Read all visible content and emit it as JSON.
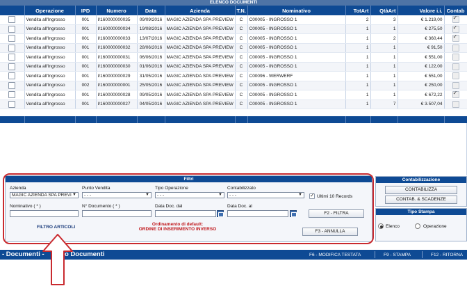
{
  "documents": {
    "title": "ELENCO DOCUMENTI",
    "columns": [
      "Operazione",
      "IPD",
      "Numero",
      "Data",
      "Azienda",
      "T.N.",
      "Nominativo",
      "TotArt",
      "QtàArt",
      "Valore i.i.",
      "Contab"
    ],
    "rows": [
      {
        "operazione": "Vendita all'Ingrosso",
        "ipd": "001",
        "numero": "I/160000000035",
        "data": "09/09/2016",
        "azienda": "MAGIC AZIENDA SPA PREVIEW",
        "tn": "C",
        "nominativo": "C00005 - INGROSSO 1",
        "totart": "2",
        "qtaart": "3",
        "valore": "€ 1.219,00",
        "contab": true,
        "selected": false
      },
      {
        "operazione": "Vendita all'Ingrosso",
        "ipd": "001",
        "numero": "I/160000000034",
        "data": "19/08/2016",
        "azienda": "MAGIC AZIENDA SPA PREVIEW",
        "tn": "C",
        "nominativo": "C00005 - INGROSSO 1",
        "totart": "1",
        "qtaart": "1",
        "valore": "€ 275,50",
        "contab": true,
        "selected": false
      },
      {
        "operazione": "Vendita all'Ingrosso",
        "ipd": "001",
        "numero": "I/160000000033",
        "data": "13/07/2016",
        "azienda": "MAGIC AZIENDA SPA PREVIEW",
        "tn": "C",
        "nominativo": "C00005 - INGROSSO 1",
        "totart": "1",
        "qtaart": "2",
        "valore": "€ 360,44",
        "contab": true,
        "selected": false
      },
      {
        "operazione": "Vendita all'Ingrosso",
        "ipd": "001",
        "numero": "I/160000000032",
        "data": "28/06/2016",
        "azienda": "MAGIC AZIENDA SPA PREVIEW",
        "tn": "C",
        "nominativo": "C00005 - INGROSSO 1",
        "totart": "1",
        "qtaart": "1",
        "valore": "€ 91,50",
        "contab": false,
        "selected": false
      },
      {
        "operazione": "Vendita all'Ingrosso",
        "ipd": "001",
        "numero": "I/160000000031",
        "data": "06/06/2016",
        "azienda": "MAGIC AZIENDA SPA PREVIEW",
        "tn": "C",
        "nominativo": "C00005 - INGROSSO 1",
        "totart": "1",
        "qtaart": "1",
        "valore": "€ 551,00",
        "contab": false,
        "selected": false
      },
      {
        "operazione": "Vendita all'Ingrosso",
        "ipd": "001",
        "numero": "I/160000000030",
        "data": "01/06/2016",
        "azienda": "MAGIC AZIENDA SPA PREVIEW",
        "tn": "C",
        "nominativo": "C00005 - INGROSSO 1",
        "totart": "1",
        "qtaart": "1",
        "valore": "€ 122,00",
        "contab": false,
        "selected": false
      },
      {
        "operazione": "Vendita all'Ingrosso",
        "ipd": "001",
        "numero": "I/160000000029",
        "data": "31/05/2016",
        "azienda": "MAGIC AZIENDA SPA PREVIEW",
        "tn": "C",
        "nominativo": "C00096 - WERWERF",
        "totart": "1",
        "qtaart": "1",
        "valore": "€ 551,00",
        "contab": false,
        "selected": false
      },
      {
        "operazione": "Vendita all'Ingrosso",
        "ipd": "002",
        "numero": "I/160000000001",
        "data": "25/05/2016",
        "azienda": "MAGIC AZIENDA SPA PREVIEW",
        "tn": "C",
        "nominativo": "C00005 - INGROSSO 1",
        "totart": "1",
        "qtaart": "1",
        "valore": "€ 250,00",
        "contab": false,
        "selected": false
      },
      {
        "operazione": "Vendita all'Ingrosso",
        "ipd": "001",
        "numero": "I/160000000028",
        "data": "09/05/2016",
        "azienda": "MAGIC AZIENDA SPA PREVIEW",
        "tn": "C",
        "nominativo": "C00005 - INGROSSO 1",
        "totart": "1",
        "qtaart": "1",
        "valore": "€ 672,22",
        "contab": true,
        "selected": false
      },
      {
        "operazione": "Vendita all'Ingrosso",
        "ipd": "001",
        "numero": "I/160000000027",
        "data": "04/05/2016",
        "azienda": "MAGIC AZIENDA SPA PREVIEW",
        "tn": "C",
        "nominativo": "C00005 - INGROSSO 1",
        "totart": "1",
        "qtaart": "7",
        "valore": "€ 3.507,04",
        "contab": false,
        "selected": false
      }
    ]
  },
  "filters": {
    "title": "Filtri",
    "azienda_label": "Azienda",
    "azienda_value": "MAGIC AZIENDA SPA PREVI",
    "punto_vendita_label": "Punto Vendita",
    "punto_vendita_value": "- - -",
    "tipo_operazione_label": "Tipo Operazione",
    "tipo_operazione_value": "- - -",
    "contabilizzato_label": "Contabilizzato",
    "contabilizzato_value": "- - -",
    "ultimi_label": "Ultimi 10 Records",
    "ultimi_checked": true,
    "nominativo_label": "Nominativo ( * )",
    "n_documento_label": "N° Documento ( * )",
    "data_dal_label": "Data Doc. dal",
    "data_al_label": "Data Doc. al",
    "filtra_button": "F2 - FILTRA",
    "annulla_button": "F3 - ANNULLA",
    "filtro_articoli": "FILTRO ARTICOLI",
    "ordinamento_line1": "Ordinamento di default:",
    "ordinamento_line2": "ORDINE DI INSERIMENTO INVERSO"
  },
  "contabilizzazione": {
    "title": "Contabilizzazione",
    "contabilizza_button": "CONTABILIZZA",
    "scadenze_button": "CONTAB. & SCADENZE"
  },
  "tipo_stampa": {
    "title": "Tipo Stampa",
    "options": [
      {
        "label": "Elenco",
        "selected": true
      },
      {
        "label": "Operazione",
        "selected": false
      }
    ]
  },
  "bottom_bar": {
    "left_text": "- Documenti - ",
    "left_text_2": "o Documenti",
    "f6": "F6 - MODIFICA TESTATA",
    "f9": "F9 - STAMPA",
    "f12": "F12 - RITORNA"
  },
  "colors": {
    "header_blue": "#0e4a94",
    "annotation_red": "#c92a2f"
  }
}
